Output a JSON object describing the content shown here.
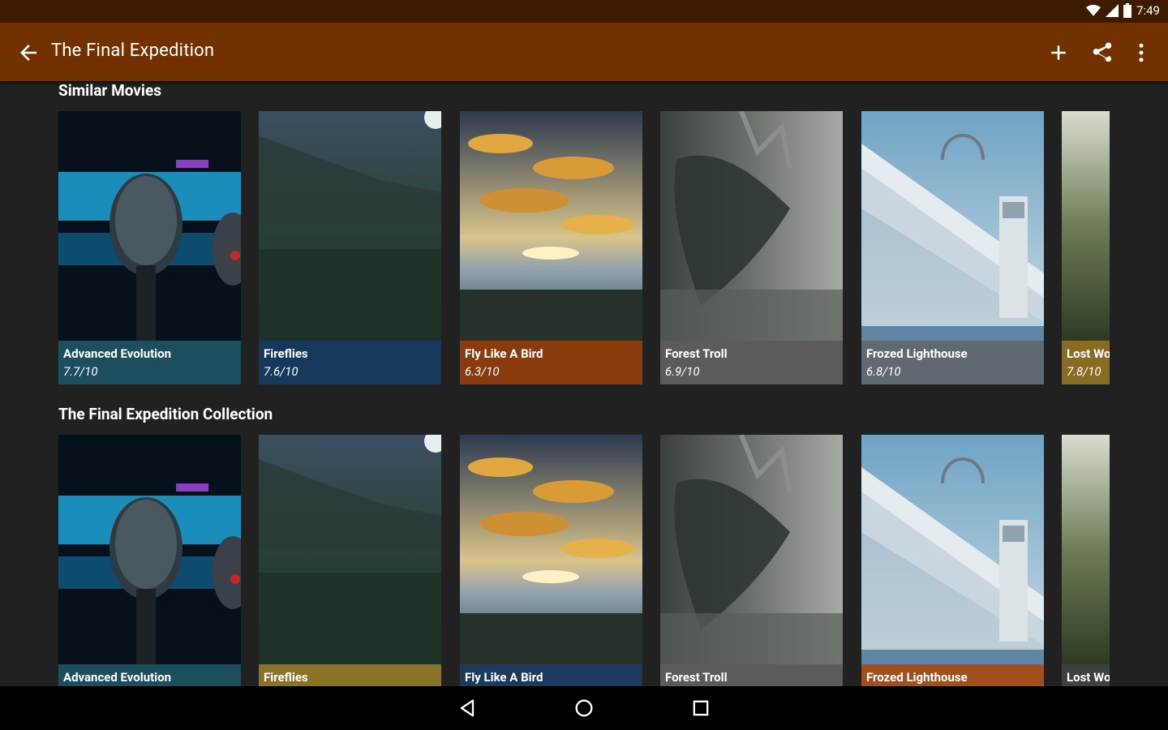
{
  "status": {
    "time": "7:49"
  },
  "appbar": {
    "title": "The Final Expedition"
  },
  "sections": [
    {
      "title": "Similar Movies",
      "movies": [
        {
          "title": "Advanced Evolution",
          "rating": "7.7/10",
          "color": "#1d4e5e"
        },
        {
          "title": "Fireflies",
          "rating": "7.6/10",
          "color": "#16385c"
        },
        {
          "title": "Fly Like A Bird",
          "rating": "6.3/10",
          "color": "#8a3b0e"
        },
        {
          "title": "Forest Troll",
          "rating": "6.9/10",
          "color": "#5b5b5b"
        },
        {
          "title": "Frozed Lighthouse",
          "rating": "6.8/10",
          "color": "#5f6a70"
        },
        {
          "title": "Lost Wo",
          "rating": "7.8/10",
          "color": "#8a6b22"
        }
      ]
    },
    {
      "title": "The Final Expedition Collection",
      "movies": [
        {
          "title": "Advanced Evolution",
          "color": "#1d4e5e"
        },
        {
          "title": "Fireflies",
          "color": "#8a7227"
        },
        {
          "title": "Fly Like A Bird",
          "color": "#1d3a5e"
        },
        {
          "title": "Forest Troll",
          "color": "#5b5b5b"
        },
        {
          "title": "Frozed Lighthouse",
          "color": "#a1501d"
        },
        {
          "title": "Lost Wo",
          "color": "#404040"
        }
      ]
    }
  ],
  "icons": {
    "back": "arrow-left-icon",
    "add": "plus-icon",
    "share": "share-icon",
    "more": "more-vertical-icon"
  }
}
